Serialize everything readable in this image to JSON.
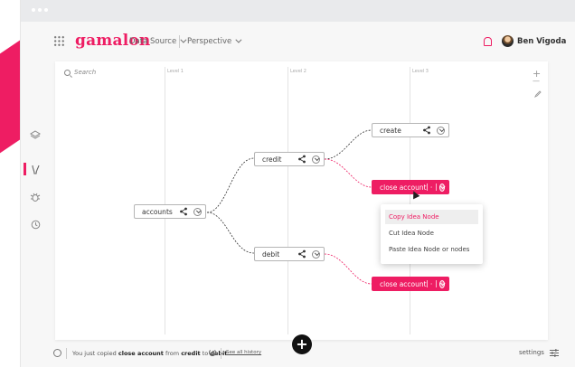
{
  "app": {
    "logo": "gamalon",
    "menus": [
      {
        "label": "Data Source"
      },
      {
        "label": "Perspective"
      }
    ],
    "user_name": "Ben Vigoda"
  },
  "canvas": {
    "search_placeholder": "Search",
    "levels": [
      "Level 1",
      "Level 2",
      "Level 3"
    ],
    "zoom_in": "+",
    "zoom_out": "—"
  },
  "nodes": {
    "accounts": "accounts",
    "credit": "credit",
    "debit": "debit",
    "create": "create",
    "close_account_credit": "close account",
    "close_account_debit": "close account"
  },
  "context_menu": {
    "items": [
      {
        "label": "Copy Idea Node"
      },
      {
        "label": "Cut Idea Node"
      },
      {
        "label": "Paste Idea Node or nodes"
      }
    ]
  },
  "status": {
    "prefix": "You just copied",
    "item": "close account",
    "from_word": "from",
    "source": "credit",
    "to_word": "to",
    "target": "debit",
    "history_link": "See all history",
    "fab_label": "+",
    "settings_label": "settings"
  },
  "colors": {
    "accent": "#ee1d63"
  },
  "icons": {
    "rail": [
      "layers-icon",
      "lightbulb-icon",
      "bug-icon",
      "history-icon"
    ],
    "node_actions": [
      "share-icon",
      "chevron-down-icon"
    ]
  }
}
